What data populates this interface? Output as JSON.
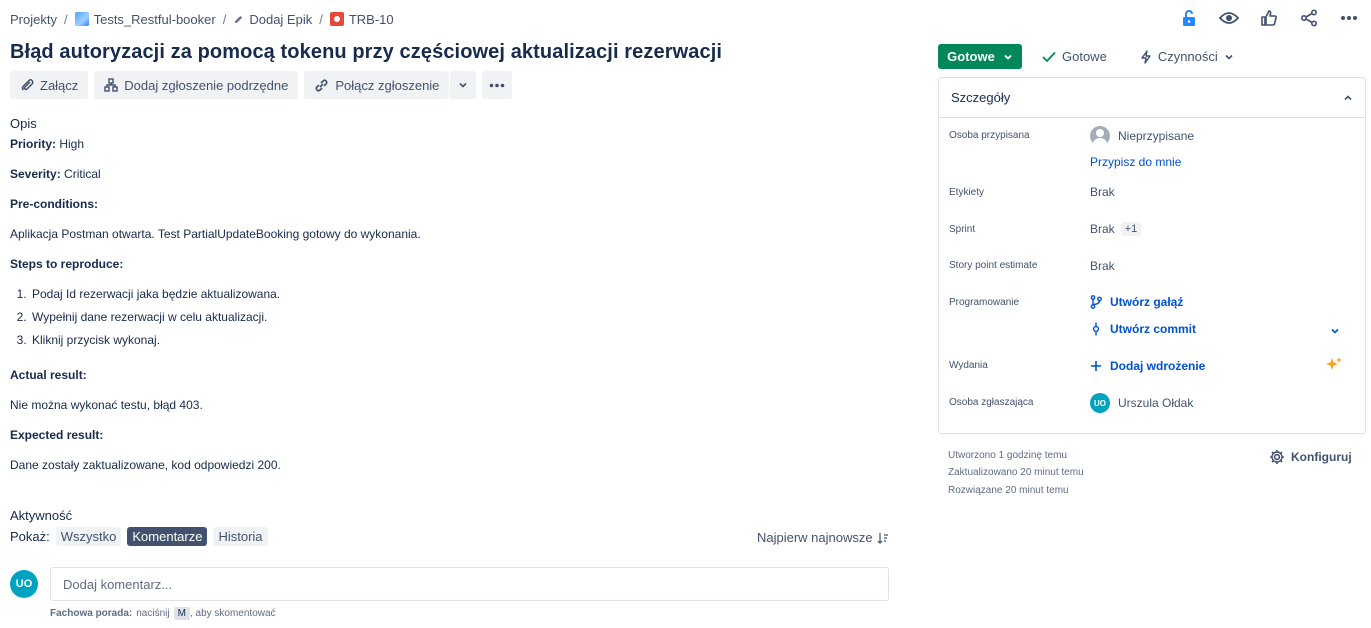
{
  "breadcrumb": {
    "projects": "Projekty",
    "project": "Tests_Restful-booker",
    "epic": "Dodaj Epik",
    "issue": "TRB-10"
  },
  "title": "Błąd autoryzacji za pomocą tokenu przy częściowej aktualizacji rezerwacji",
  "toolbar": {
    "attach": "Załącz",
    "add_child": "Dodaj zgłoszenie podrzędne",
    "link_issue": "Połącz zgłoszenie"
  },
  "description": {
    "heading": "Opis",
    "priority_label": "Priority:",
    "priority_value": " High",
    "severity_label": "Severity:",
    "severity_value": " Critical",
    "preconditions_label": "Pre-conditions:",
    "preconditions_text": "Aplikacja Postman otwarta. Test PartialUpdateBooking gotowy do wykonania.",
    "steps_label": "Steps to reproduce:",
    "steps": [
      "Podaj Id rezerwacji jaka będzie aktualizowana.",
      "Wypełnij dane rezerwacji w celu aktualizacji.",
      "Kliknij przycisk wykonaj."
    ],
    "actual_label": "Actual result:",
    "actual_text": "Nie można wykonać testu, błąd 403.",
    "expected_label": "Expected result:",
    "expected_text": "Dane zostały zaktualizowane, kod odpowiedzi 200."
  },
  "activity": {
    "title": "Aktywność",
    "show_label": "Pokaż:",
    "filters": [
      "Wszystko",
      "Komentarze",
      "Historia"
    ],
    "sort": "Najpierw najnowsze",
    "avatar_initials": "UO",
    "comment_placeholder": "Dodaj komentarz...",
    "tip_bold": "Fachowa porada:",
    "tip_press": "naciśnij",
    "tip_key": "M",
    "tip_rest": ", aby skomentować"
  },
  "status": {
    "button": "Gotowe",
    "done": "Gotowe",
    "actions": "Czynności"
  },
  "details": {
    "title": "Szczegóły",
    "assignee_label": "Osoba przypisana",
    "assignee_value": "Nieprzypisane",
    "assign_to_me": "Przypisz do mnie",
    "labels_label": "Etykiety",
    "labels_value": "Brak",
    "sprint_label": "Sprint",
    "sprint_value": "Brak",
    "sprint_badge": "+1",
    "story_label": "Story point estimate",
    "story_value": "Brak",
    "dev_label": "Programowanie",
    "create_branch": "Utwórz gałąź",
    "create_commit": "Utwórz commit",
    "releases_label": "Wydania",
    "add_deploy": "Dodaj wdrożenie",
    "reporter_label": "Osoba zgłaszająca",
    "reporter_initials": "UO",
    "reporter_value": "Urszula Ołdak"
  },
  "meta": {
    "created": "Utworzono 1 godzinę temu",
    "updated": "Zaktualizowano 20 minut temu",
    "resolved": "Rozwiązane 20 minut temu",
    "configure": "Konfiguruj"
  },
  "colors": {
    "status_green": "#00875a",
    "link_blue": "#0052cc",
    "avatar_teal": "#00a3bf"
  }
}
